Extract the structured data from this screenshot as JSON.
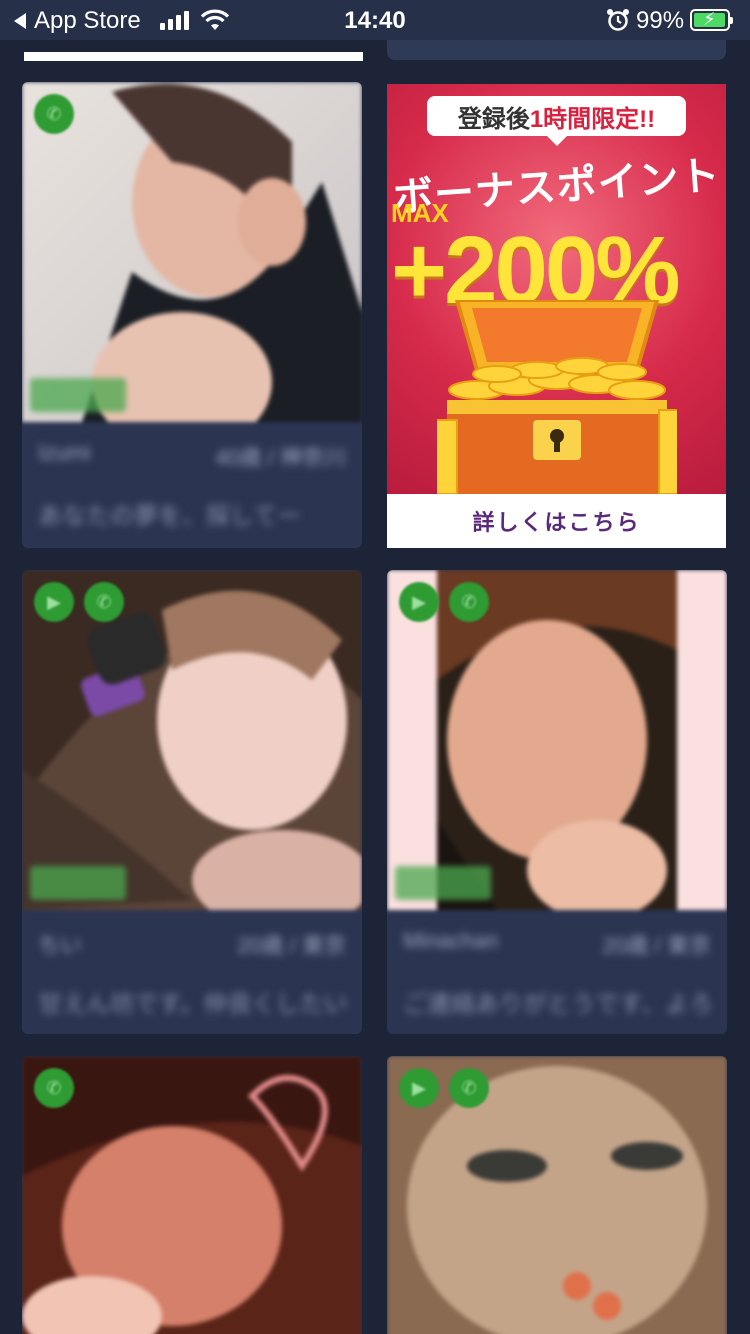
{
  "status_bar": {
    "back_label": "App Store",
    "time": "14:40",
    "battery_pct": "99%",
    "battery_level": 0.99,
    "icons": [
      "signal-icon",
      "wifi-icon",
      "alarm-icon",
      "battery-charging-icon"
    ]
  },
  "ad": {
    "banner_prefix": "登録後",
    "banner_highlight": "1時間限定!!",
    "title": "ボーナスポイント",
    "max_label": "MAX",
    "amount": "+200%",
    "cta": "詳しくはこちら"
  },
  "cards": [
    {
      "meta_left": "Izumi",
      "meta_right": "40歳 / 神奈川",
      "message": "あなたの夢を、探してー",
      "badges": [
        "call-icon"
      ]
    },
    {
      "meta_left": "ちい",
      "meta_right": "20歳 / 東京",
      "message": "甘えん坊です。仲良くしたいー",
      "badges": [
        "video-icon",
        "call-icon"
      ]
    },
    {
      "meta_left": "Minachan",
      "meta_right": "20歳 / 東京",
      "message": "ご連絡ありがとうです、よろしくー",
      "badges": [
        "video-icon",
        "call-icon"
      ]
    },
    {
      "badges": [
        "call-icon"
      ]
    },
    {
      "badges": [
        "video-icon",
        "call-icon"
      ]
    }
  ],
  "colors": {
    "background": "#1d2438",
    "card": "#2b3552",
    "status_bar": "#263049",
    "badge_green": "#2e9b33",
    "ad_red": "#d62a4a",
    "ad_gold": "#ffe43a"
  }
}
